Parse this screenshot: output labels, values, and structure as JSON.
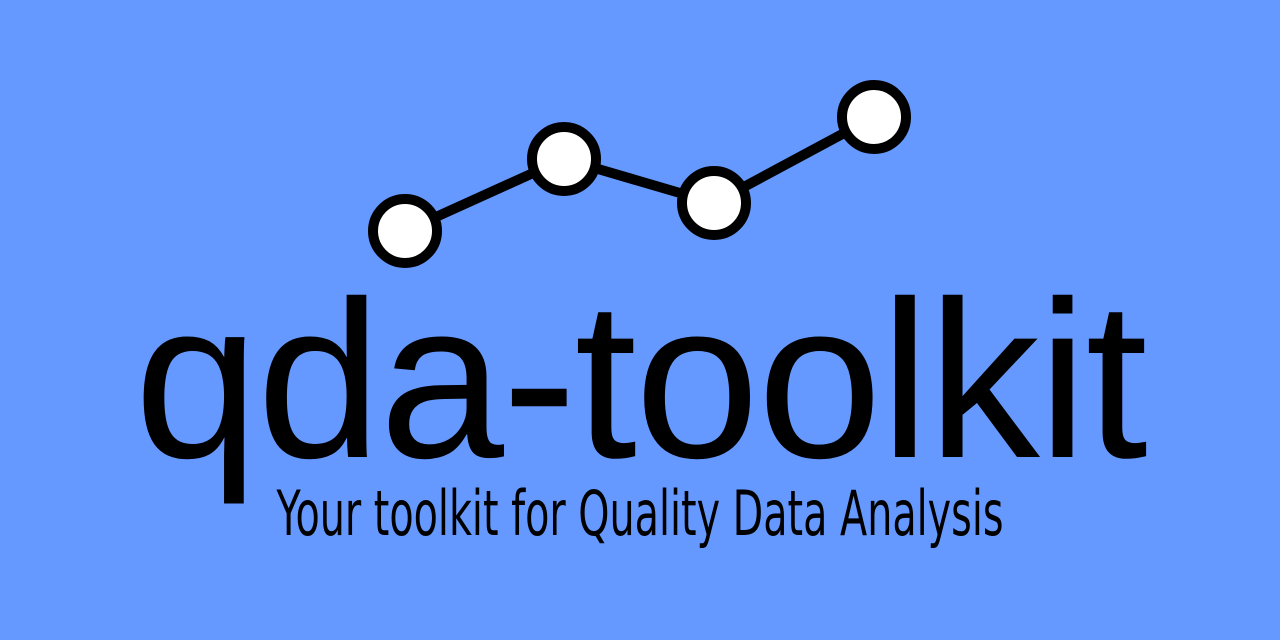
{
  "banner": {
    "background_color": "#6699ff",
    "text_color": "#000000",
    "title": "qda-toolkit",
    "tagline": "Your toolkit for Quality Data Analysis"
  },
  "logo": {
    "description_icon": "line-chart-icon",
    "node_fill": "#ffffff",
    "stroke_color": "#000000"
  }
}
